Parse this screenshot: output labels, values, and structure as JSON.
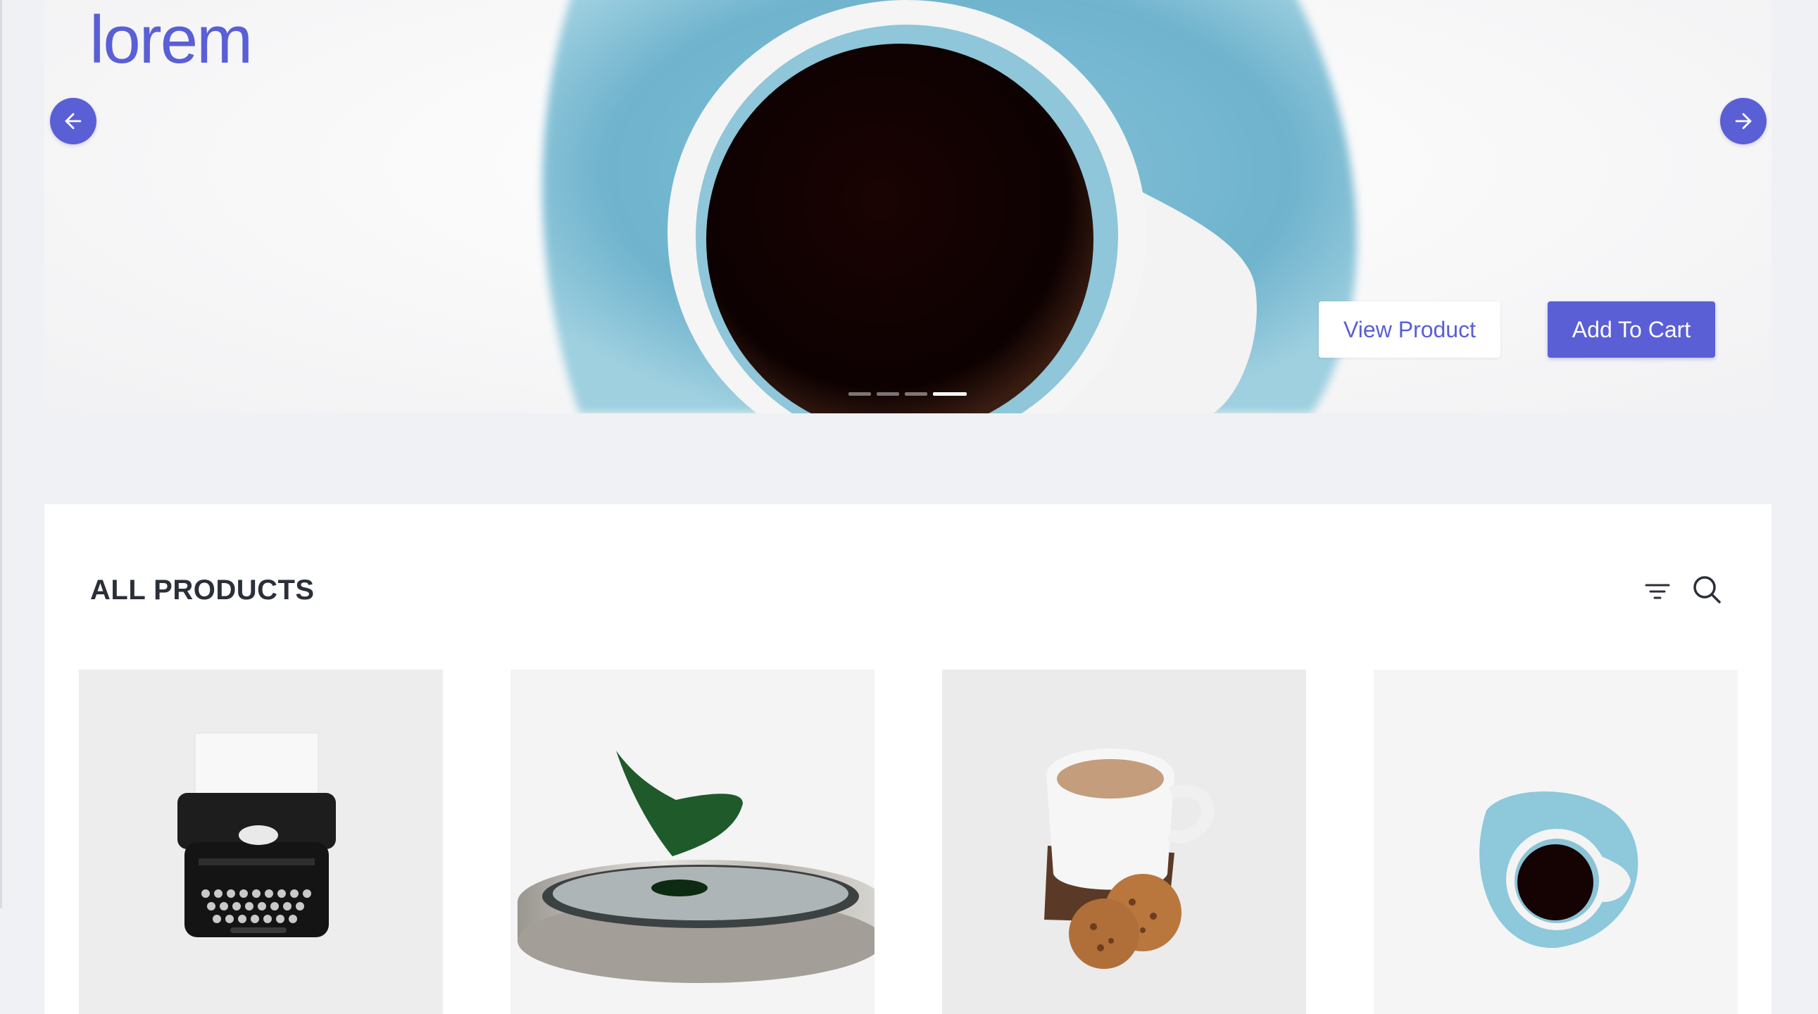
{
  "hero": {
    "title": "lorem",
    "prev_icon": "arrow-left-icon",
    "next_icon": "arrow-right-icon",
    "view_button_label": "View Product",
    "cart_button_label": "Add To Cart",
    "slide_count": 4,
    "active_slide": 4,
    "accent_color": "#5a5fd6"
  },
  "products": {
    "title": "ALL PRODUCTS",
    "filter_icon": "filter-icon",
    "search_icon": "search-icon",
    "items": [
      {
        "image": "typewriter"
      },
      {
        "image": "spinning-top"
      },
      {
        "image": "tea-cup-with-cookies"
      },
      {
        "image": "blue-coffee-cup"
      }
    ]
  }
}
